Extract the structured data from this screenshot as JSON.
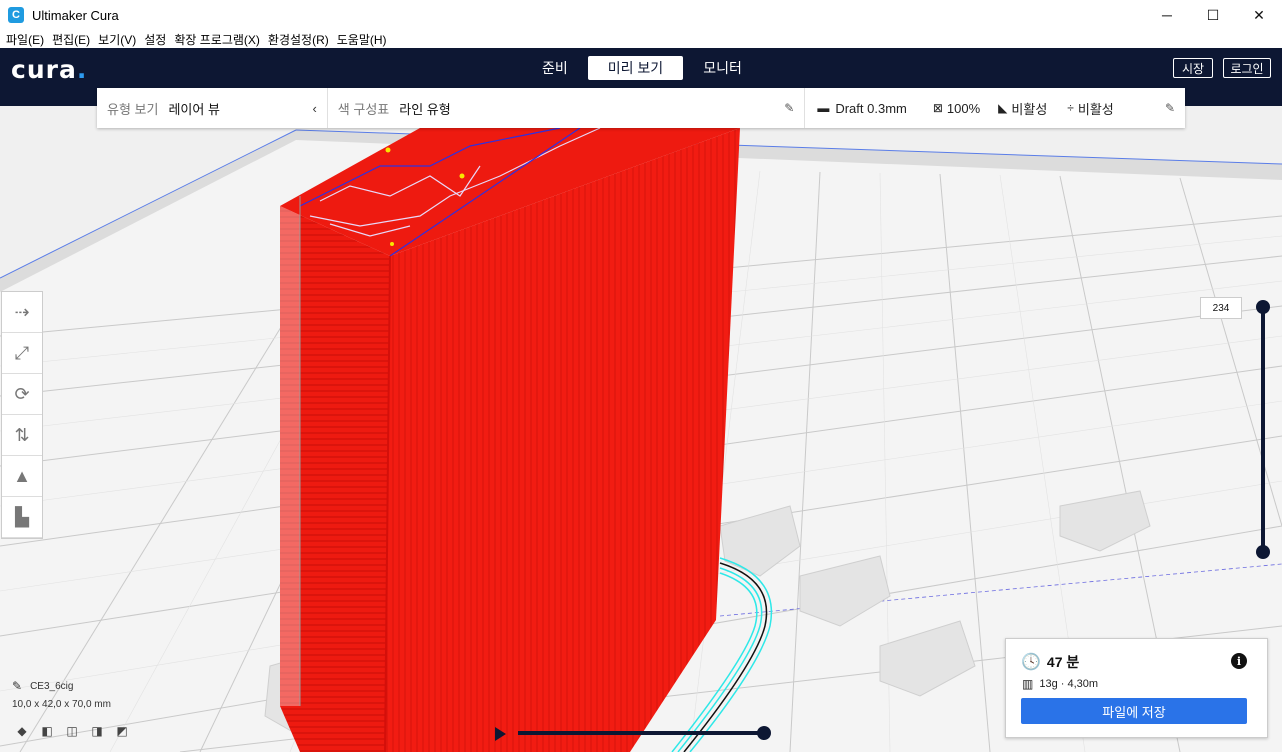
{
  "window": {
    "title": "Ultimaker Cura",
    "controls": [
      "─",
      "☐",
      "✕"
    ]
  },
  "menu": [
    "파일(E)",
    "편집(E)",
    "보기(V)",
    "설정",
    "확장 프로그램(X)",
    "환경설정(R)",
    "도움말(H)"
  ],
  "header": {
    "logo": "cura",
    "tabs": [
      "준비",
      "미리 보기",
      "모니터"
    ],
    "active_tab": "미리 보기",
    "marketplace": "시장",
    "login": "로그인"
  },
  "toolbar": {
    "view_type_label": "유형 보기",
    "view_type_value": "레이어 뷰",
    "color_scheme_label": "색 구성표",
    "color_scheme_value": "라인 유형",
    "profile": "Draft 0.3mm",
    "infill": "100%",
    "support": "비활성",
    "adhesion": "비활성"
  },
  "layer_slider": {
    "current_layer": "234",
    "level": 1.0
  },
  "object": {
    "name": "CE3_6cig",
    "dimensions": "10,0 x 42,0 x 70,0 mm"
  },
  "print_info": {
    "time": "47 분",
    "material": "13g · 4,30m",
    "save_button": "파일에 저장"
  },
  "colors": {
    "header": "#0d1733",
    "accent": "#2a73e8",
    "model": "#e8120e",
    "travel": "#2ee8e8"
  }
}
